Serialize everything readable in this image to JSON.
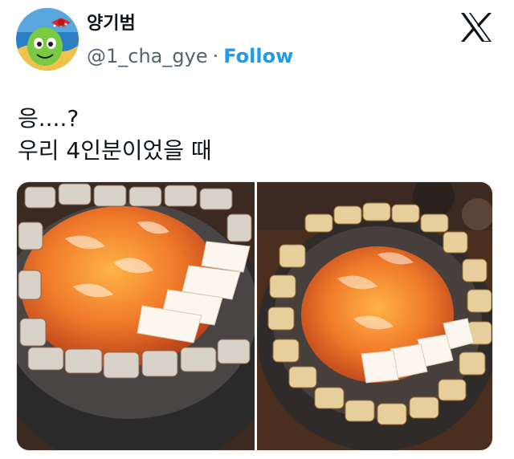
{
  "post": {
    "display_name": "양기범",
    "handle": "@1_cha_gye",
    "separator": "·",
    "follow_label": "Follow",
    "text_lines": [
      "응....?",
      "우리 4인분이었을 때"
    ]
  },
  "icons": {
    "platform": "x-logo-icon",
    "avatar": "cartoon-avatar"
  },
  "colors": {
    "accent": "#1d9bf0",
    "text": "#0f1419",
    "muted": "#536471"
  }
}
